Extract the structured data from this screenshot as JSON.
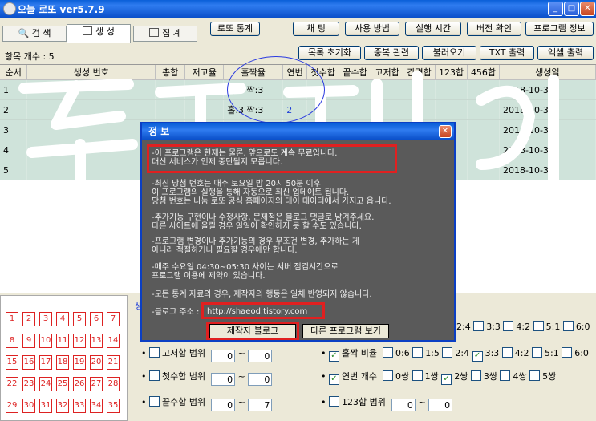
{
  "window": {
    "title": "오늘 로또 ver5.7.9"
  },
  "tabs": [
    {
      "label": "검 색",
      "icon": "search-icon"
    },
    {
      "label": "생 성",
      "icon": "generate-icon"
    },
    {
      "label": "집 계",
      "icon": "tally-icon"
    }
  ],
  "toolbar_top": {
    "stats": "로또 통계",
    "chat": "채 팅",
    "howto": "사용 방법",
    "runtime": "실행 시간",
    "version": "버전 확인",
    "proginfo": "프로그램 정보"
  },
  "toolbar_second": {
    "reset": "목록 초기화",
    "dup": "중복 관련",
    "load": "불러오기",
    "txt": "TXT 출력",
    "excel": "엑셀 출력"
  },
  "item_count": "항목 개수 : 5",
  "table": {
    "columns": [
      "순서",
      "생성 번호",
      "총합",
      "저고율",
      "홀짝율",
      "연번",
      "첫수합",
      "끝수합",
      "고저합",
      "간격합",
      "123합",
      "456합",
      "생성일"
    ],
    "rows": [
      [
        "1",
        "",
        "",
        "",
        "홀:3 짝:3",
        "2",
        "",
        "",
        "",
        "",
        "",
        "",
        "2018-10-31"
      ],
      [
        "2",
        "",
        "",
        "",
        "홀:3 짝:3",
        "2",
        "",
        "",
        "",
        "",
        "",
        "",
        "2018-10-31"
      ],
      [
        "3",
        "",
        "",
        "",
        "",
        "",
        "",
        "",
        "",
        "",
        "",
        "",
        "2018-10-31"
      ],
      [
        "4",
        "",
        "",
        "",
        "",
        "",
        "",
        "",
        "",
        "",
        "",
        "",
        "2018-10-31"
      ],
      [
        "5",
        "",
        "",
        "",
        "",
        "",
        "",
        "",
        "",
        "",
        "",
        "",
        "2018-10-31"
      ]
    ]
  },
  "number_grid": [
    "1",
    "2",
    "3",
    "4",
    "5",
    "6",
    "7",
    "8",
    "9",
    "10",
    "11",
    "12",
    "13",
    "14",
    "15",
    "16",
    "17",
    "18",
    "19",
    "20",
    "21",
    "22",
    "23",
    "24",
    "25",
    "26",
    "27",
    "28",
    "29",
    "30",
    "31",
    "32",
    "33",
    "34",
    "35"
  ],
  "options": {
    "section_label": "생",
    "hilo_range": "고저합 범위",
    "first_sum_range": "첫수합 범위",
    "last_sum_range": "끝수합 범위",
    "spin_zero": "0",
    "spin_seven": "7",
    "tilde": "~",
    "oddeven_ratio": "홀짝 비율",
    "consec_count": "연번 개수",
    "sum123_range": "123합 범위",
    "ratios": [
      "0:6",
      "1:5",
      "2:4",
      "3:3",
      "4:2",
      "5:1",
      "6:0"
    ],
    "consec": [
      "0쌍",
      "1쌍",
      "2쌍",
      "3쌍",
      "4쌍",
      "5쌍"
    ]
  },
  "dialog": {
    "title": "정 보",
    "p1": "-이 프로그램은 현재는 물론, 앞으로도 계속 무료입니다.",
    "p1b": "대신 서비스가 언제 중단될지 모릅니다.",
    "p2": "-최신 당첨 번호는 매주 토요일 밤 20시 50분 이후",
    "p2b": "이 프로그램의 실행을 통해 자동으로 최신 업데이트 됩니다.",
    "p2c": "당첨 번호는 나눔 로또 공식 홈페이지의 데이 데이터에서 가지고 옵니다.",
    "p3": "-추가기능 구현이나 수정사항, 문제점은 블로그 댓글로 남겨주세요.",
    "p3b": "다른 사이트에 올릴 경우 일일이 확인하지 못 할 수도 있습니다.",
    "p4": "-프로그램 변경이나 추가기능의 경우 무조건 변경, 추가하는 게",
    "p4b": "아니라 적절하거나 필요할 경우에만 합니다.",
    "p5": "-매주 수요일 04:30~05:30 사이는 서버 점검시간으로",
    "p5b": "프로그램 이용에 제약이 있습니다.",
    "p6": "-모든 통계 자료의 경우, 제작자의 행동은 일체 반영되지 않습니다.",
    "blog_label": "-블로그 주소 :",
    "blog_url": "http://shaeod.tistory.com",
    "btn_blog": "제작자 블로그",
    "btn_other": "다른 프로그램 보기"
  },
  "colors": {
    "accent_red": "#e02020",
    "row_green": "#cfe3da",
    "title_blue": "#0a5fd8"
  }
}
